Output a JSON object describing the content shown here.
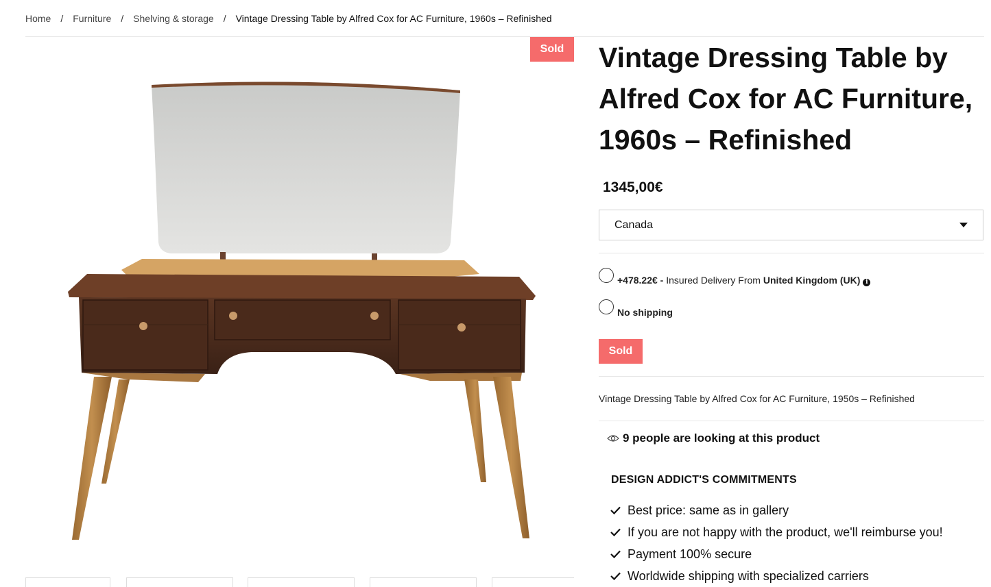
{
  "breadcrumb": {
    "items": [
      "Home",
      "Furniture",
      "Shelving & storage"
    ],
    "separator": "/",
    "current": "Vintage Dressing Table by Alfred Cox for AC Furniture, 1960s – Refinished"
  },
  "gallery": {
    "badge": "Sold",
    "image_icon": "dressing-table-illustration",
    "thumbnail_count": 5
  },
  "product": {
    "title": "Vintage Dressing Table by Alfred Cox for AC Furniture, 1960s – Refinished",
    "price": "1345,00€",
    "country_select": {
      "value": "Canada",
      "icon": "caret-down-icon"
    },
    "shipping_options": [
      {
        "price": "+478.22€ -",
        "text": " Insured Delivery From ",
        "origin": "United Kingdom (UK)",
        "icon": "info-icon"
      },
      {
        "label": "No shipping"
      }
    ],
    "status_button": "Sold",
    "short_description": "Vintage Dressing Table by Alfred Cox for AC Furniture, 1950s – Refinished",
    "viewers": {
      "icon": "eye-icon",
      "text": "9 people are looking at this product"
    }
  },
  "commitments": {
    "title": "DESIGN ADDICT'S COMMITMENTS",
    "icon": "check-icon",
    "items": [
      "Best price: same as in gallery",
      "If you are not happy with the product, we'll reimburse you!",
      "Payment 100% secure",
      "Worldwide shipping with specialized carriers"
    ]
  },
  "colors": {
    "sold_badge": "#f56b6b",
    "text": "#111111",
    "rule": "#e6e6e6"
  }
}
